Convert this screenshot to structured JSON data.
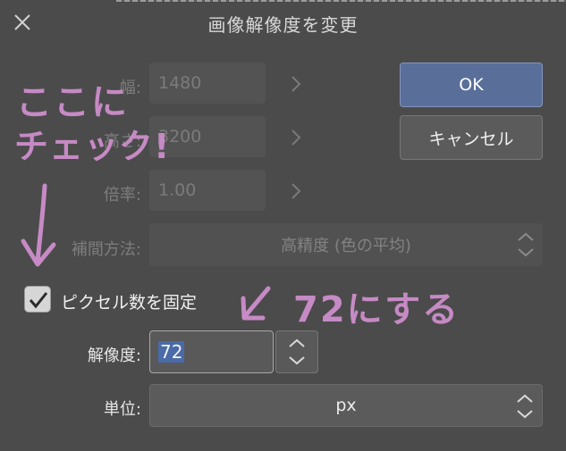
{
  "window": {
    "title": "画像解像度を変更"
  },
  "fields": {
    "width": {
      "label": "幅:",
      "value": "1480"
    },
    "height": {
      "label": "高さ:",
      "value": "3200"
    },
    "scale": {
      "label": "倍率:",
      "value": "1.00"
    },
    "interpolation": {
      "label": "補間方法:",
      "value": "高精度 (色の平均)"
    },
    "resolution": {
      "label": "解像度:",
      "value": "72"
    },
    "unit": {
      "label": "単位:",
      "value": "px"
    }
  },
  "checkbox": {
    "label": "ピクセル数を固定",
    "checked": true
  },
  "buttons": {
    "ok": "OK",
    "cancel": "キャンセル"
  },
  "annotations": {
    "note1_line1": "ここに",
    "note1_line2": "チェック!",
    "note2": "72にする",
    "color": "#c68ac5"
  },
  "colors": {
    "background": "#4b4b4b",
    "accent": "#5a6e9a",
    "selection": "#4a6aa8"
  }
}
